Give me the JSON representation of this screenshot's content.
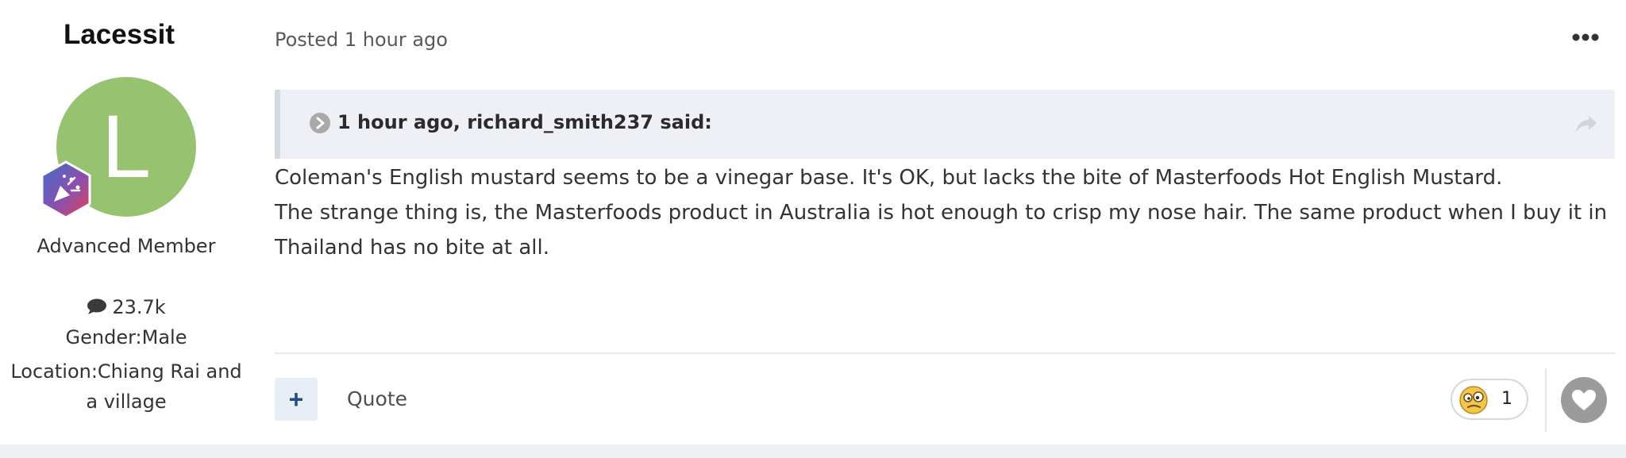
{
  "author": {
    "username": "Lacessit",
    "avatar_letter": "L",
    "avatar_color": "#97c26f",
    "rank": "Advanced Member",
    "posts": "23.7k",
    "gender": "Gender:Male",
    "location": "Location:Chiang Rai and a village"
  },
  "post": {
    "posted": "Posted 1 hour ago",
    "quote_cite": "1 hour ago, richard_smith237 said:",
    "paragraphs": [
      "Coleman's English mustard seems to be a vinegar base. It's OK, but lacks the bite of Masterfoods Hot English Mustard.",
      "The strange thing is, the Masterfoods product in Australia is hot enough to crisp my nose hair. The same product  when I buy it in Thailand has no bite at all."
    ]
  },
  "footer": {
    "add_label": "+",
    "quote_label": "Quote",
    "reaction_count": "1",
    "reaction_icon": "confused-face-icon",
    "like_icon": "heart-icon"
  }
}
